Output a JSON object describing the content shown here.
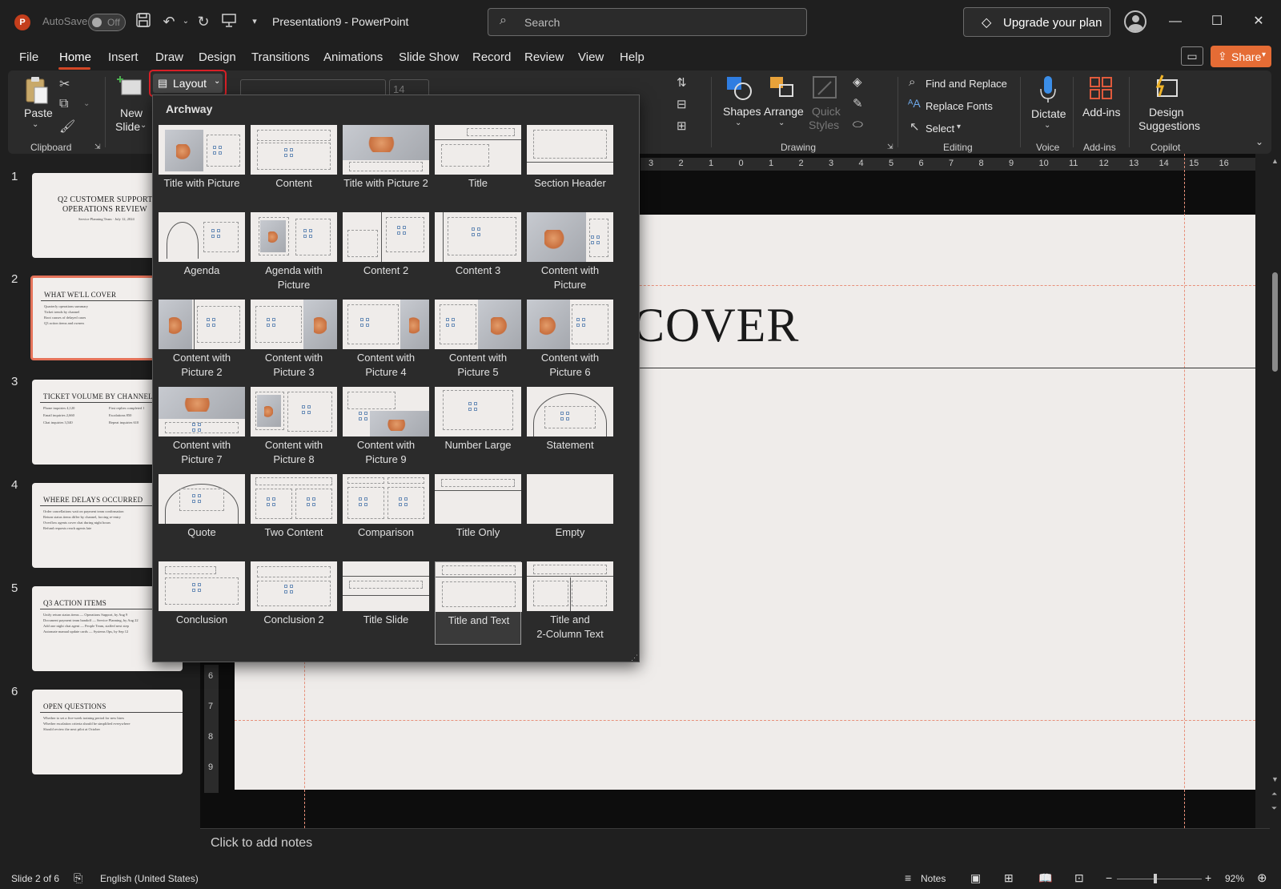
{
  "app": {
    "logo_letter": "P",
    "autosave_label": "AutoSave",
    "autosave_state": "Off",
    "document_title": "Presentation9  -  PowerPoint",
    "search_placeholder": "Search",
    "upgrade_label": "Upgrade your plan"
  },
  "menu": {
    "items": [
      "File",
      "Home",
      "Insert",
      "Draw",
      "Design",
      "Transitions",
      "Animations",
      "Slide Show",
      "Record",
      "Review",
      "View",
      "Help"
    ],
    "active": "Home",
    "share_label": "Share"
  },
  "ribbon": {
    "paste": "Paste",
    "clipboard": "Clipboard",
    "new_slide_1": "New",
    "new_slide_2": "Slide",
    "layout": "Layout",
    "font_size": "14",
    "shapes": "Shapes",
    "arrange": "Arrange",
    "quick_styles_1": "Quick",
    "quick_styles_2": "Styles",
    "drawing": "Drawing",
    "find_replace": "Find and Replace",
    "replace_fonts": "Replace Fonts",
    "select": "Select",
    "editing": "Editing",
    "dictate": "Dictate",
    "voice": "Voice",
    "addins": "Add-ins",
    "addins_group": "Add-ins",
    "design_sugg_1": "Design",
    "design_sugg_2": "Suggestions",
    "copilot": "Copilot"
  },
  "layout_gallery": {
    "theme_name": "Archway",
    "items": [
      {
        "l1": "Title with Picture",
        "l2": ""
      },
      {
        "l1": "Content",
        "l2": ""
      },
      {
        "l1": "Title with Picture 2",
        "l2": ""
      },
      {
        "l1": "Title",
        "l2": ""
      },
      {
        "l1": "Section Header",
        "l2": ""
      },
      {
        "l1": "Agenda",
        "l2": ""
      },
      {
        "l1": "Agenda with",
        "l2": "Picture"
      },
      {
        "l1": "Content 2",
        "l2": ""
      },
      {
        "l1": "Content 3",
        "l2": ""
      },
      {
        "l1": "Content with",
        "l2": "Picture"
      },
      {
        "l1": "Content with",
        "l2": "Picture 2"
      },
      {
        "l1": "Content with",
        "l2": "Picture 3"
      },
      {
        "l1": "Content with",
        "l2": "Picture 4"
      },
      {
        "l1": "Content with",
        "l2": "Picture 5"
      },
      {
        "l1": "Content with",
        "l2": "Picture 6"
      },
      {
        "l1": "Content with",
        "l2": "Picture 7"
      },
      {
        "l1": "Content with",
        "l2": "Picture 8"
      },
      {
        "l1": "Content with",
        "l2": "Picture 9"
      },
      {
        "l1": "Number Large",
        "l2": ""
      },
      {
        "l1": "Statement",
        "l2": ""
      },
      {
        "l1": "Quote",
        "l2": ""
      },
      {
        "l1": "Two Content",
        "l2": ""
      },
      {
        "l1": "Comparison",
        "l2": ""
      },
      {
        "l1": "Title Only",
        "l2": ""
      },
      {
        "l1": "Empty",
        "l2": ""
      },
      {
        "l1": "Conclusion",
        "l2": ""
      },
      {
        "l1": "Conclusion 2",
        "l2": ""
      },
      {
        "l1": "Title Slide",
        "l2": ""
      },
      {
        "l1": "Title and Text",
        "l2": ""
      },
      {
        "l1": "Title and",
        "l2": "2-Column Text"
      }
    ],
    "selected_index": 28
  },
  "slides": [
    {
      "num": "1",
      "title": "Q2 CUSTOMER SUPPORT",
      "title2": "OPERATIONS REVIEW",
      "sub": "Service Planning Team · July 12, 2024",
      "lines": []
    },
    {
      "num": "2",
      "title": "WHAT WE'LL COVER",
      "title2": "",
      "sub": "",
      "lines": [
        "Quarterly operations summary",
        "Ticket trends by channel",
        "Root causes of delayed cases",
        "Q3 action items and owners"
      ]
    },
    {
      "num": "3",
      "title": "TICKET VOLUME BY CHANNEL",
      "title2": "",
      "sub": "",
      "lines": [
        "Phone inquiries 4,120",
        "Email inquiries 2,660",
        "Chat inquiries 3,540"
      ],
      "lines_right": [
        "First replies completed 1",
        "Escalations 850",
        "Repeat inquiries 610"
      ]
    },
    {
      "num": "4",
      "title": "WHERE DELAYS OCCURRED",
      "title2": "",
      "sub": "",
      "lines": [
        "Order cancellations wait on payment team confirmation",
        "Return status items differ by channel, forcing re-entry",
        "Overflow agents cover chat during night hours",
        "Refund requests reach agents late"
      ]
    },
    {
      "num": "5",
      "title": "Q3 ACTION ITEMS",
      "title2": "",
      "sub": "",
      "lines": [
        "Unify return status items — Operations Support, by Aug 9",
        "Document payment team handoff — Service Planning, by Aug 22",
        "Add one night chat agent — People Team, staffed next step",
        "Automate manual update cards — Systems Ops, by Sep 12"
      ]
    },
    {
      "num": "6",
      "title": "OPEN QUESTIONS",
      "title2": "",
      "sub": "",
      "lines": [
        "Whether to set a five-week training period for new hires",
        "Whether escalation criteria should be simplified everywhere",
        "Should review the next pilot at October"
      ]
    }
  ],
  "current_slide": {
    "title_visible": "COVER",
    "notes_placeholder": "Click to add notes"
  },
  "status": {
    "slide_of": "Slide 2 of 6",
    "language": "English (United States)",
    "notes": "Notes",
    "zoom": "92%"
  },
  "ruler": {
    "top": [
      "3",
      "2",
      "1",
      "0",
      "1",
      "2",
      "3",
      "4",
      "5",
      "6",
      "7",
      "8",
      "9",
      "10",
      "11",
      "12",
      "13",
      "14",
      "15",
      "16"
    ],
    "left": [
      "6",
      "7",
      "8",
      "9"
    ]
  },
  "colors": {
    "accent": "#d24726",
    "share": "#e56c35",
    "selection_outline": "#d81f26",
    "guide": "#e7907a"
  }
}
